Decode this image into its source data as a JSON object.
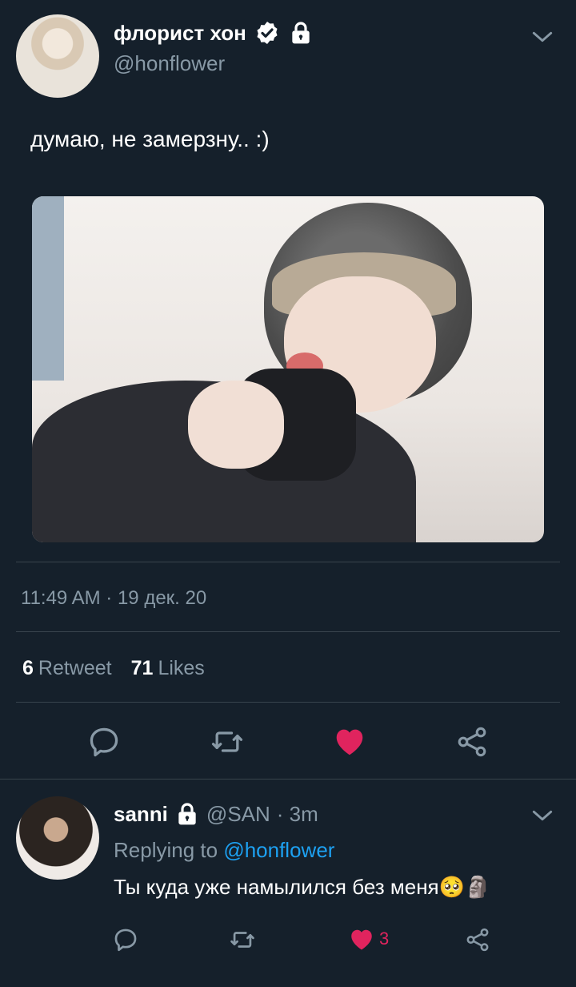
{
  "tweet": {
    "author_name": "флорист хон",
    "author_handle": "@honflower",
    "text": "думаю, не замерзну.. :)",
    "timestamp": "11:49 AM · 19 дек. 20",
    "retweet_count": "6",
    "retweet_label": "Retweet",
    "like_count": "71",
    "like_label": "Likes"
  },
  "reply": {
    "author_name": "sanni",
    "author_handle": "@SAN",
    "time": "· 3m",
    "replying_prefix": "Replying to",
    "replying_to": "@honflower",
    "text": "Ты куда уже намылился без меня",
    "emoji": "🥺🗿",
    "like_count": "3"
  },
  "colors": {
    "background": "#15202b",
    "muted": "#8899a6",
    "link": "#1da1f2",
    "like": "#e0245e",
    "divider": "#38444d"
  },
  "icons": [
    "verified-badge-icon",
    "lock-icon",
    "chevron-down-icon",
    "reply-icon",
    "retweet-icon",
    "heart-icon",
    "share-icon"
  ]
}
